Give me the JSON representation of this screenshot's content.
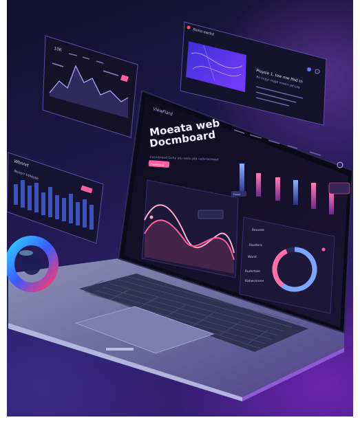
{
  "colors": {
    "background_dark": "#120f2c",
    "background_purple": "#3a1f7a",
    "accent_pink": "#ff5fa2",
    "accent_blue": "#6e8cff",
    "accent_violet": "#8a5cff"
  },
  "screen": {
    "brand": "ViewFlard",
    "hero_title_line1": "Moeata web",
    "hero_title_line2": "Docmboard",
    "hero_subtitle": "Fosmbreod Guhy atu nedu pbt valie boreeet",
    "cta_label": "Fosmbreod",
    "legend_label": "Fossd",
    "donut_labels": [
      "Reoveie",
      "Ravtlore",
      "Warst",
      "Rudnrtaie",
      "Rahwcsrone"
    ]
  },
  "floating_panel_right": {
    "header_title": "Romo ewrbd",
    "heading": "Playsie 1, tow mw lthd tn",
    "sub_heading": "Ro ncgyi vojge vmeor pd Lee"
  },
  "floating_panel_left_top": {
    "top_label": "10K"
  },
  "floating_panel_left_mid": {
    "title": "Whnnrt",
    "subtitle": "Nsnerr Inhesse"
  }
}
